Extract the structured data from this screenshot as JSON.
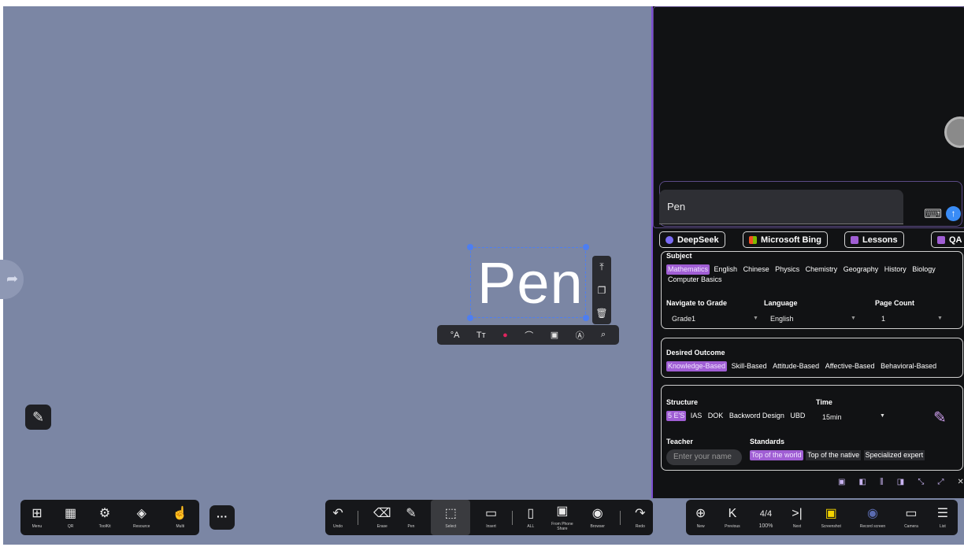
{
  "canvas": {
    "text_element": "Pen",
    "side_tools": [
      "⤒",
      "❐",
      "🗑"
    ],
    "text_tools": [
      "°A",
      "Tт",
      "●",
      "⌒",
      "▣",
      "Ⓐ",
      "⌕"
    ],
    "text_color_swatch": "#e0245e"
  },
  "ai_panel": {
    "input_value": "Pen",
    "send_icon": "↑",
    "tabs": [
      {
        "label": "DeepSeek",
        "icon_color": "#7b6cf6"
      },
      {
        "label": "Microsoft Bing",
        "icon_color": "#f4b400"
      },
      {
        "label": "Lessons",
        "icon_color": "#a05ed4"
      },
      {
        "label": "QA",
        "icon_color": "#a05ed4"
      }
    ],
    "subject_label": "Subject",
    "subjects_row1": [
      "Mathematics",
      "English",
      "Chinese",
      "Physics",
      "Chemistry",
      "Geography",
      "History",
      "Biology"
    ],
    "subjects_row2": [
      "Computer Basics"
    ],
    "grade_label": "Navigate to Grade",
    "grade_value": "Grade1",
    "language_label": "Language",
    "language_value": "English",
    "page_count_label": "Page Count",
    "page_count_value": "1",
    "outcome_label": "Desired Outcome",
    "outcomes": [
      "Knowledge-Based",
      "Skill-Based",
      "Attitude-Based",
      "Affective-Based",
      "Behavioral-Based"
    ],
    "structure_label": "Structure",
    "structures": [
      "5 E'S",
      "IAS",
      "DOK",
      "Backword Design",
      "UBD"
    ],
    "time_label": "Time",
    "time_value": "15min",
    "teacher_label": "Teacher",
    "teacher_placeholder": "Enter your name",
    "standards_label": "Standards",
    "standards": [
      "Top of the world",
      "Top of the native",
      "Specialized expert"
    ],
    "panel_tools": [
      "▣",
      "◧",
      "⫼",
      "◨",
      "⤡",
      "⤢",
      "✕"
    ]
  },
  "toolbar_left": [
    {
      "icon": "⊞",
      "label": "Menu"
    },
    {
      "icon": "▦",
      "label": "QR"
    },
    {
      "icon": "⚙",
      "label": "ToolKit"
    },
    {
      "icon": "◈",
      "label": "Resource"
    },
    {
      "icon": "☝",
      "label": "Multi"
    }
  ],
  "more_label": "···",
  "toolbar_center": [
    {
      "icon": "↶",
      "label": "Undo"
    },
    {
      "icon": "⌫",
      "label": "Erase"
    },
    {
      "icon": "✎",
      "label": "Pen"
    },
    {
      "icon": "⬚",
      "label": "Select"
    },
    {
      "icon": "▭",
      "label": "Insert"
    },
    {
      "icon": "▯",
      "label": "ALL"
    },
    {
      "icon": "▣",
      "label": "From Phone Share"
    },
    {
      "icon": "◉",
      "label": "Browser"
    },
    {
      "icon": "↷",
      "label": "Redo"
    }
  ],
  "toolbar_right": [
    {
      "icon": "⊕",
      "label": "New"
    },
    {
      "icon": "K",
      "label": "Previous"
    },
    {
      "icon": "4/4",
      "label": "100%"
    },
    {
      "icon": ">|",
      "label": "Next"
    },
    {
      "icon": "▣",
      "label": "Screenshot"
    },
    {
      "icon": "◉",
      "label": "Record screen"
    },
    {
      "icon": "▭",
      "label": "Camera"
    },
    {
      "icon": "☰",
      "label": "List"
    }
  ]
}
